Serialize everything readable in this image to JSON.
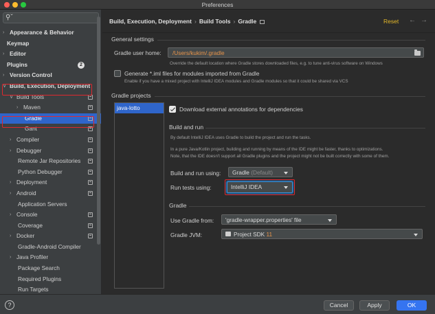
{
  "window": {
    "title": "Preferences"
  },
  "sidebar": {
    "search_icon": "search-icon",
    "items": [
      {
        "label": "Appearance & Behavior",
        "bold": true,
        "arrow": true
      },
      {
        "label": "Keymap",
        "bold": true
      },
      {
        "label": "Editor",
        "bold": true,
        "arrow": true
      },
      {
        "label": "Plugins",
        "bold": true,
        "badge": "2"
      },
      {
        "label": "Version Control",
        "bold": true,
        "arrow": true
      },
      {
        "label": "Build, Execution, Deployment",
        "bold": true,
        "arrow": true,
        "expanded": true
      },
      {
        "label": "Build Tools",
        "arrow": true,
        "expanded": true
      },
      {
        "label": "Maven",
        "arrow": true
      },
      {
        "label": "Gradle",
        "selected": true
      },
      {
        "label": "Gant"
      },
      {
        "label": "Compiler",
        "arrow": true
      },
      {
        "label": "Debugger",
        "arrow": true
      },
      {
        "label": "Remote Jar Repositories"
      },
      {
        "label": "Python Debugger"
      },
      {
        "label": "Deployment",
        "arrow": true
      },
      {
        "label": "Android",
        "arrow": true
      },
      {
        "label": "Application Servers"
      },
      {
        "label": "Console",
        "arrow": true
      },
      {
        "label": "Coverage"
      },
      {
        "label": "Docker",
        "arrow": true
      },
      {
        "label": "Gradle-Android Compiler"
      },
      {
        "label": "Java Profiler",
        "arrow": true
      },
      {
        "label": "Package Search"
      },
      {
        "label": "Required Plugins"
      },
      {
        "label": "Run Targets"
      }
    ]
  },
  "header": {
    "breadcrumbs": [
      "Build, Execution, Deployment",
      "Build Tools",
      "Gradle"
    ],
    "reset_label": "Reset"
  },
  "general": {
    "title": "General settings",
    "user_home_label": "Gradle user home:",
    "user_home_value": "/Users/kukim/.gradle",
    "user_home_hint": "Override the default location where Gradle stores downloaded files, e.g. to tune anti-virus software on Windows",
    "iml_label": "Generate *.iml files for modules imported from Gradle",
    "iml_hint": "Enable if you have a mixed project with IntelliJ IDEA modules and Gradle modules so that it could be shared via VCS",
    "iml_checked": false
  },
  "projects": {
    "title": "Gradle projects",
    "list": [
      "java-lotto"
    ],
    "download_annotations_label": "Download external annotations for dependencies",
    "download_annotations_checked": true
  },
  "build_and_run": {
    "title": "Build and run",
    "desc1": "By default IntelliJ IDEA uses Gradle to build the project and run the tasks.",
    "desc2": "In a pure Java/Kotlin project, building and running by means of the IDE might be faster, thanks to optimizations.",
    "desc3": "Note, that the IDE doesn't support all Gradle plugins and the project might not be built correctly with some of them.",
    "build_run_label": "Build and run using:",
    "build_run_value": "Gradle",
    "build_run_suffix": "(Default)",
    "run_tests_label": "Run tests using:",
    "run_tests_value": "IntelliJ IDEA"
  },
  "gradle": {
    "title": "Gradle",
    "use_from_label": "Use Gradle from:",
    "use_from_value": "'gradle-wrapper.properties' file",
    "jvm_label": "Gradle JVM:",
    "jvm_value": "Project SDK",
    "jvm_version": "11"
  },
  "footer": {
    "help": "?",
    "cancel": "Cancel",
    "apply": "Apply",
    "ok": "OK"
  },
  "colors": {
    "accent": "#3574f0",
    "selection": "#2f65ca",
    "highlight_box": "#e0282e",
    "reset": "#e4b829",
    "path_value": "#e8944a"
  }
}
